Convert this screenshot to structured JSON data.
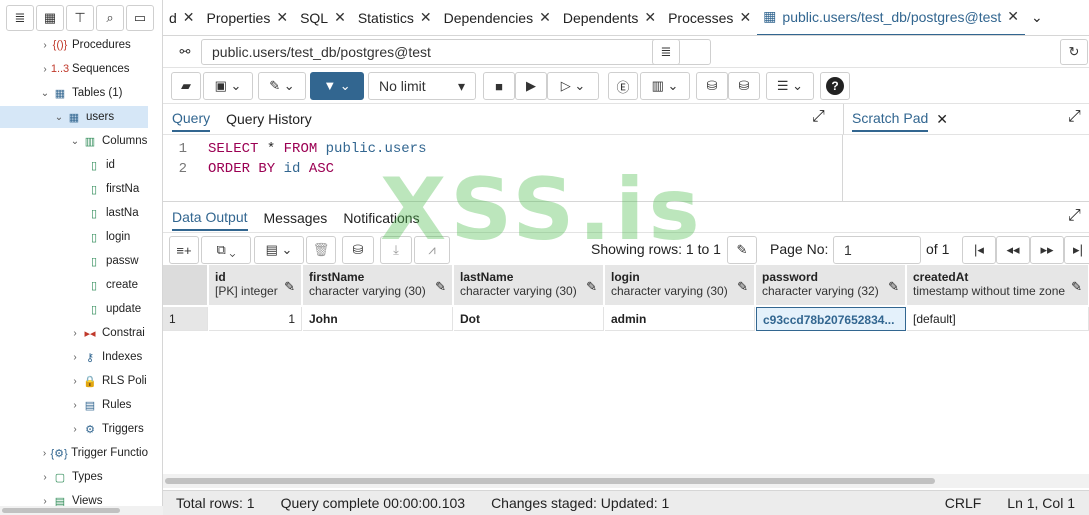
{
  "tree": {
    "items": [
      {
        "label": "Procedures",
        "icon": "procedures-icon",
        "glyph": "{()}",
        "caret": "›"
      },
      {
        "label": "Sequences",
        "icon": "sequences-icon",
        "glyph": "1..3",
        "caret": "›"
      },
      {
        "label": "Tables (1)",
        "icon": "tables-icon",
        "glyph": "▦",
        "caret": "⌄"
      },
      {
        "label": "users",
        "icon": "table-icon",
        "glyph": "▦",
        "caret": "⌄"
      },
      {
        "label": "Columns",
        "icon": "columns-icon",
        "glyph": "▥",
        "caret": "⌄"
      },
      {
        "label": "id",
        "icon": "column-icon",
        "glyph": "▯",
        "caret": ""
      },
      {
        "label": "firstNa",
        "icon": "column-icon",
        "glyph": "▯",
        "caret": ""
      },
      {
        "label": "lastNa",
        "icon": "column-icon",
        "glyph": "▯",
        "caret": ""
      },
      {
        "label": "login",
        "icon": "column-icon",
        "glyph": "▯",
        "caret": ""
      },
      {
        "label": "passw",
        "icon": "column-icon",
        "glyph": "▯",
        "caret": ""
      },
      {
        "label": "create",
        "icon": "column-icon",
        "glyph": "▯",
        "caret": ""
      },
      {
        "label": "update",
        "icon": "column-icon",
        "glyph": "▯",
        "caret": ""
      },
      {
        "label": "Constrai",
        "icon": "constraints-icon",
        "glyph": "▸◂",
        "caret": "›"
      },
      {
        "label": "Indexes",
        "icon": "indexes-icon",
        "glyph": "⚷",
        "caret": "›"
      },
      {
        "label": "RLS Poli",
        "icon": "rls-policies-icon",
        "glyph": "🔒",
        "caret": "›"
      },
      {
        "label": "Rules",
        "icon": "rules-icon",
        "glyph": "▤",
        "caret": "›"
      },
      {
        "label": "Triggers",
        "icon": "triggers-icon",
        "glyph": "⚙",
        "caret": "›"
      },
      {
        "label": "Trigger Functio",
        "icon": "trigger-functions-icon",
        "glyph": "{⚙}",
        "caret": "›"
      },
      {
        "label": "Types",
        "icon": "types-icon",
        "glyph": "▢",
        "caret": "›"
      },
      {
        "label": "Views",
        "icon": "views-icon",
        "glyph": "▤",
        "caret": "›"
      }
    ]
  },
  "tabs": [
    {
      "label": "d"
    },
    {
      "label": "Properties"
    },
    {
      "label": "SQL"
    },
    {
      "label": "Statistics"
    },
    {
      "label": "Dependencies"
    },
    {
      "label": "Dependents"
    },
    {
      "label": "Processes"
    },
    {
      "label": "public.users/test_db/postgres@test"
    }
  ],
  "connection": {
    "value": "public.users/test_db/postgres@test"
  },
  "toolbar": {
    "limit": "No limit"
  },
  "query_panel": {
    "tab_query": "Query",
    "tab_history": "Query History",
    "scratch": "Scratch Pad"
  },
  "editor": {
    "line1_no": "1",
    "line2_no": "2",
    "l1_kw1": "SELECT",
    "l1_star": " * ",
    "l1_kw2": "FROM",
    "l1_tbl": " public.users",
    "l2_kw1": "ORDER BY",
    "l2_col": " id",
    "l2_kw2": " ASC"
  },
  "output_tabs": {
    "data": "Data Output",
    "messages": "Messages",
    "notifications": "Notifications"
  },
  "pager": {
    "showing": "Showing rows: 1 to 1",
    "page_label": "Page No:",
    "page": "1",
    "of": "of 1"
  },
  "grid": {
    "columns": [
      {
        "name": "id",
        "type": "[PK] integer"
      },
      {
        "name": "firstName",
        "type": "character varying (30)"
      },
      {
        "name": "lastName",
        "type": "character varying (30)"
      },
      {
        "name": "login",
        "type": "character varying (30)"
      },
      {
        "name": "password",
        "type": "character varying (32)"
      },
      {
        "name": "createdAt",
        "type": "timestamp without time zone"
      }
    ],
    "row_no": "1",
    "row": [
      "1",
      "John",
      "Dot",
      "admin",
      "c93ccd78b207652834...",
      "[default]"
    ]
  },
  "status": {
    "total": "Total rows: 1",
    "query": "Query complete 00:00:00.103",
    "staged": "Changes staged: Updated: 1",
    "eol": "CRLF",
    "pos": "Ln 1, Col 1"
  },
  "watermark": "XSS.is"
}
